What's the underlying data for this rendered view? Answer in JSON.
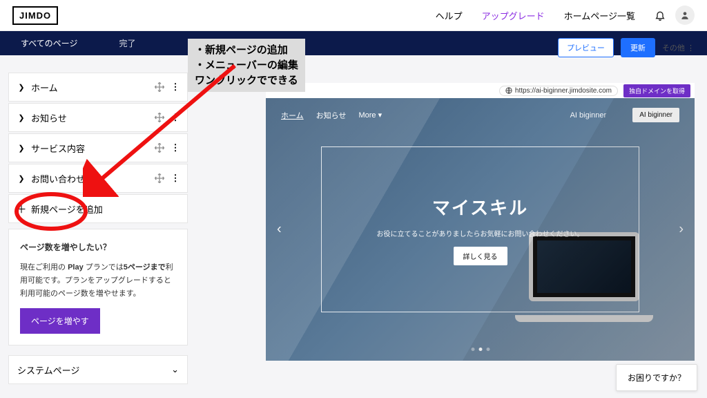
{
  "brand": "JIMDO",
  "top": {
    "help": "ヘルプ",
    "upgrade": "アップグレード",
    "sites": "ホームページ一覧"
  },
  "tabs": {
    "all": "すべてのページ",
    "done": "完了"
  },
  "actions": {
    "preview": "プレビュー",
    "update": "更新",
    "other": "その他 ⋮"
  },
  "pages": {
    "items": [
      "ホーム",
      "お知らせ",
      "サービス内容",
      "お問い合わせ"
    ],
    "add": "新規ページを追加"
  },
  "upsell": {
    "heading": "ページ数を増やしたい？",
    "body1": "現在ご利用の ",
    "body_plan": "Play",
    "body2": " プランでは",
    "body_limit": "5ページまで",
    "body3": "利用可能です。プランをアップグレードすると利用可能のページ数を増やせます。",
    "cta": "ページを増やす"
  },
  "system_pages": "システムページ",
  "preview": {
    "url": "https://ai-biginner.jimdosite.com",
    "domain_cta": "独自ドメインを取得",
    "nav": {
      "home": "ホーム",
      "news": "お知らせ",
      "more": "More ▾",
      "brand": "AI biginner",
      "cta": "AI biginner"
    },
    "hero": {
      "title": "マイスキル",
      "sub": "お役に立てることがありましたらお気軽にお問い合わせください。",
      "btn": "詳しく見る"
    }
  },
  "annotation": {
    "l1": "・新規ページの追加",
    "l2": "・メニューバーの編集",
    "l3": "ワンクリックでできる"
  },
  "help_bubble": "お困りですか？"
}
